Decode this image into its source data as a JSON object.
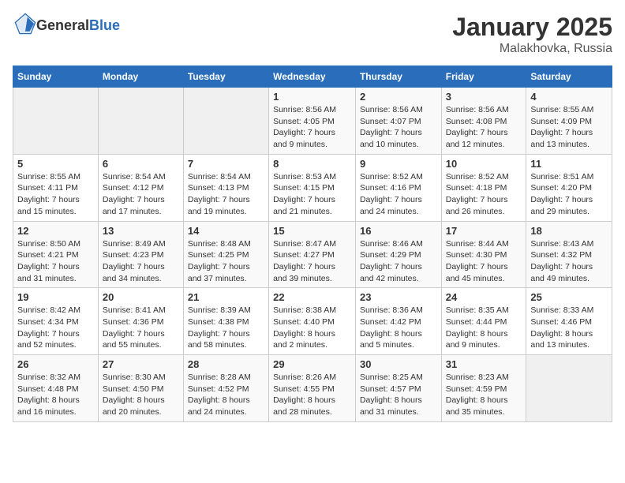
{
  "header": {
    "logo_general": "General",
    "logo_blue": "Blue",
    "title": "January 2025",
    "subtitle": "Malakhovka, Russia"
  },
  "weekdays": [
    "Sunday",
    "Monday",
    "Tuesday",
    "Wednesday",
    "Thursday",
    "Friday",
    "Saturday"
  ],
  "weeks": [
    [
      {
        "day": "",
        "sunrise": "",
        "sunset": "",
        "daylight": "",
        "empty": true
      },
      {
        "day": "",
        "sunrise": "",
        "sunset": "",
        "daylight": "",
        "empty": true
      },
      {
        "day": "",
        "sunrise": "",
        "sunset": "",
        "daylight": "",
        "empty": true
      },
      {
        "day": "1",
        "sunrise": "Sunrise: 8:56 AM",
        "sunset": "Sunset: 4:05 PM",
        "daylight": "Daylight: 7 hours and 9 minutes."
      },
      {
        "day": "2",
        "sunrise": "Sunrise: 8:56 AM",
        "sunset": "Sunset: 4:07 PM",
        "daylight": "Daylight: 7 hours and 10 minutes."
      },
      {
        "day": "3",
        "sunrise": "Sunrise: 8:56 AM",
        "sunset": "Sunset: 4:08 PM",
        "daylight": "Daylight: 7 hours and 12 minutes."
      },
      {
        "day": "4",
        "sunrise": "Sunrise: 8:55 AM",
        "sunset": "Sunset: 4:09 PM",
        "daylight": "Daylight: 7 hours and 13 minutes."
      }
    ],
    [
      {
        "day": "5",
        "sunrise": "Sunrise: 8:55 AM",
        "sunset": "Sunset: 4:11 PM",
        "daylight": "Daylight: 7 hours and 15 minutes."
      },
      {
        "day": "6",
        "sunrise": "Sunrise: 8:54 AM",
        "sunset": "Sunset: 4:12 PM",
        "daylight": "Daylight: 7 hours and 17 minutes."
      },
      {
        "day": "7",
        "sunrise": "Sunrise: 8:54 AM",
        "sunset": "Sunset: 4:13 PM",
        "daylight": "Daylight: 7 hours and 19 minutes."
      },
      {
        "day": "8",
        "sunrise": "Sunrise: 8:53 AM",
        "sunset": "Sunset: 4:15 PM",
        "daylight": "Daylight: 7 hours and 21 minutes."
      },
      {
        "day": "9",
        "sunrise": "Sunrise: 8:52 AM",
        "sunset": "Sunset: 4:16 PM",
        "daylight": "Daylight: 7 hours and 24 minutes."
      },
      {
        "day": "10",
        "sunrise": "Sunrise: 8:52 AM",
        "sunset": "Sunset: 4:18 PM",
        "daylight": "Daylight: 7 hours and 26 minutes."
      },
      {
        "day": "11",
        "sunrise": "Sunrise: 8:51 AM",
        "sunset": "Sunset: 4:20 PM",
        "daylight": "Daylight: 7 hours and 29 minutes."
      }
    ],
    [
      {
        "day": "12",
        "sunrise": "Sunrise: 8:50 AM",
        "sunset": "Sunset: 4:21 PM",
        "daylight": "Daylight: 7 hours and 31 minutes."
      },
      {
        "day": "13",
        "sunrise": "Sunrise: 8:49 AM",
        "sunset": "Sunset: 4:23 PM",
        "daylight": "Daylight: 7 hours and 34 minutes."
      },
      {
        "day": "14",
        "sunrise": "Sunrise: 8:48 AM",
        "sunset": "Sunset: 4:25 PM",
        "daylight": "Daylight: 7 hours and 37 minutes."
      },
      {
        "day": "15",
        "sunrise": "Sunrise: 8:47 AM",
        "sunset": "Sunset: 4:27 PM",
        "daylight": "Daylight: 7 hours and 39 minutes."
      },
      {
        "day": "16",
        "sunrise": "Sunrise: 8:46 AM",
        "sunset": "Sunset: 4:29 PM",
        "daylight": "Daylight: 7 hours and 42 minutes."
      },
      {
        "day": "17",
        "sunrise": "Sunrise: 8:44 AM",
        "sunset": "Sunset: 4:30 PM",
        "daylight": "Daylight: 7 hours and 45 minutes."
      },
      {
        "day": "18",
        "sunrise": "Sunrise: 8:43 AM",
        "sunset": "Sunset: 4:32 PM",
        "daylight": "Daylight: 7 hours and 49 minutes."
      }
    ],
    [
      {
        "day": "19",
        "sunrise": "Sunrise: 8:42 AM",
        "sunset": "Sunset: 4:34 PM",
        "daylight": "Daylight: 7 hours and 52 minutes."
      },
      {
        "day": "20",
        "sunrise": "Sunrise: 8:41 AM",
        "sunset": "Sunset: 4:36 PM",
        "daylight": "Daylight: 7 hours and 55 minutes."
      },
      {
        "day": "21",
        "sunrise": "Sunrise: 8:39 AM",
        "sunset": "Sunset: 4:38 PM",
        "daylight": "Daylight: 7 hours and 58 minutes."
      },
      {
        "day": "22",
        "sunrise": "Sunrise: 8:38 AM",
        "sunset": "Sunset: 4:40 PM",
        "daylight": "Daylight: 8 hours and 2 minutes."
      },
      {
        "day": "23",
        "sunrise": "Sunrise: 8:36 AM",
        "sunset": "Sunset: 4:42 PM",
        "daylight": "Daylight: 8 hours and 5 minutes."
      },
      {
        "day": "24",
        "sunrise": "Sunrise: 8:35 AM",
        "sunset": "Sunset: 4:44 PM",
        "daylight": "Daylight: 8 hours and 9 minutes."
      },
      {
        "day": "25",
        "sunrise": "Sunrise: 8:33 AM",
        "sunset": "Sunset: 4:46 PM",
        "daylight": "Daylight: 8 hours and 13 minutes."
      }
    ],
    [
      {
        "day": "26",
        "sunrise": "Sunrise: 8:32 AM",
        "sunset": "Sunset: 4:48 PM",
        "daylight": "Daylight: 8 hours and 16 minutes."
      },
      {
        "day": "27",
        "sunrise": "Sunrise: 8:30 AM",
        "sunset": "Sunset: 4:50 PM",
        "daylight": "Daylight: 8 hours and 20 minutes."
      },
      {
        "day": "28",
        "sunrise": "Sunrise: 8:28 AM",
        "sunset": "Sunset: 4:52 PM",
        "daylight": "Daylight: 8 hours and 24 minutes."
      },
      {
        "day": "29",
        "sunrise": "Sunrise: 8:26 AM",
        "sunset": "Sunset: 4:55 PM",
        "daylight": "Daylight: 8 hours and 28 minutes."
      },
      {
        "day": "30",
        "sunrise": "Sunrise: 8:25 AM",
        "sunset": "Sunset: 4:57 PM",
        "daylight": "Daylight: 8 hours and 31 minutes."
      },
      {
        "day": "31",
        "sunrise": "Sunrise: 8:23 AM",
        "sunset": "Sunset: 4:59 PM",
        "daylight": "Daylight: 8 hours and 35 minutes."
      },
      {
        "day": "",
        "sunrise": "",
        "sunset": "",
        "daylight": "",
        "empty": true
      }
    ]
  ]
}
